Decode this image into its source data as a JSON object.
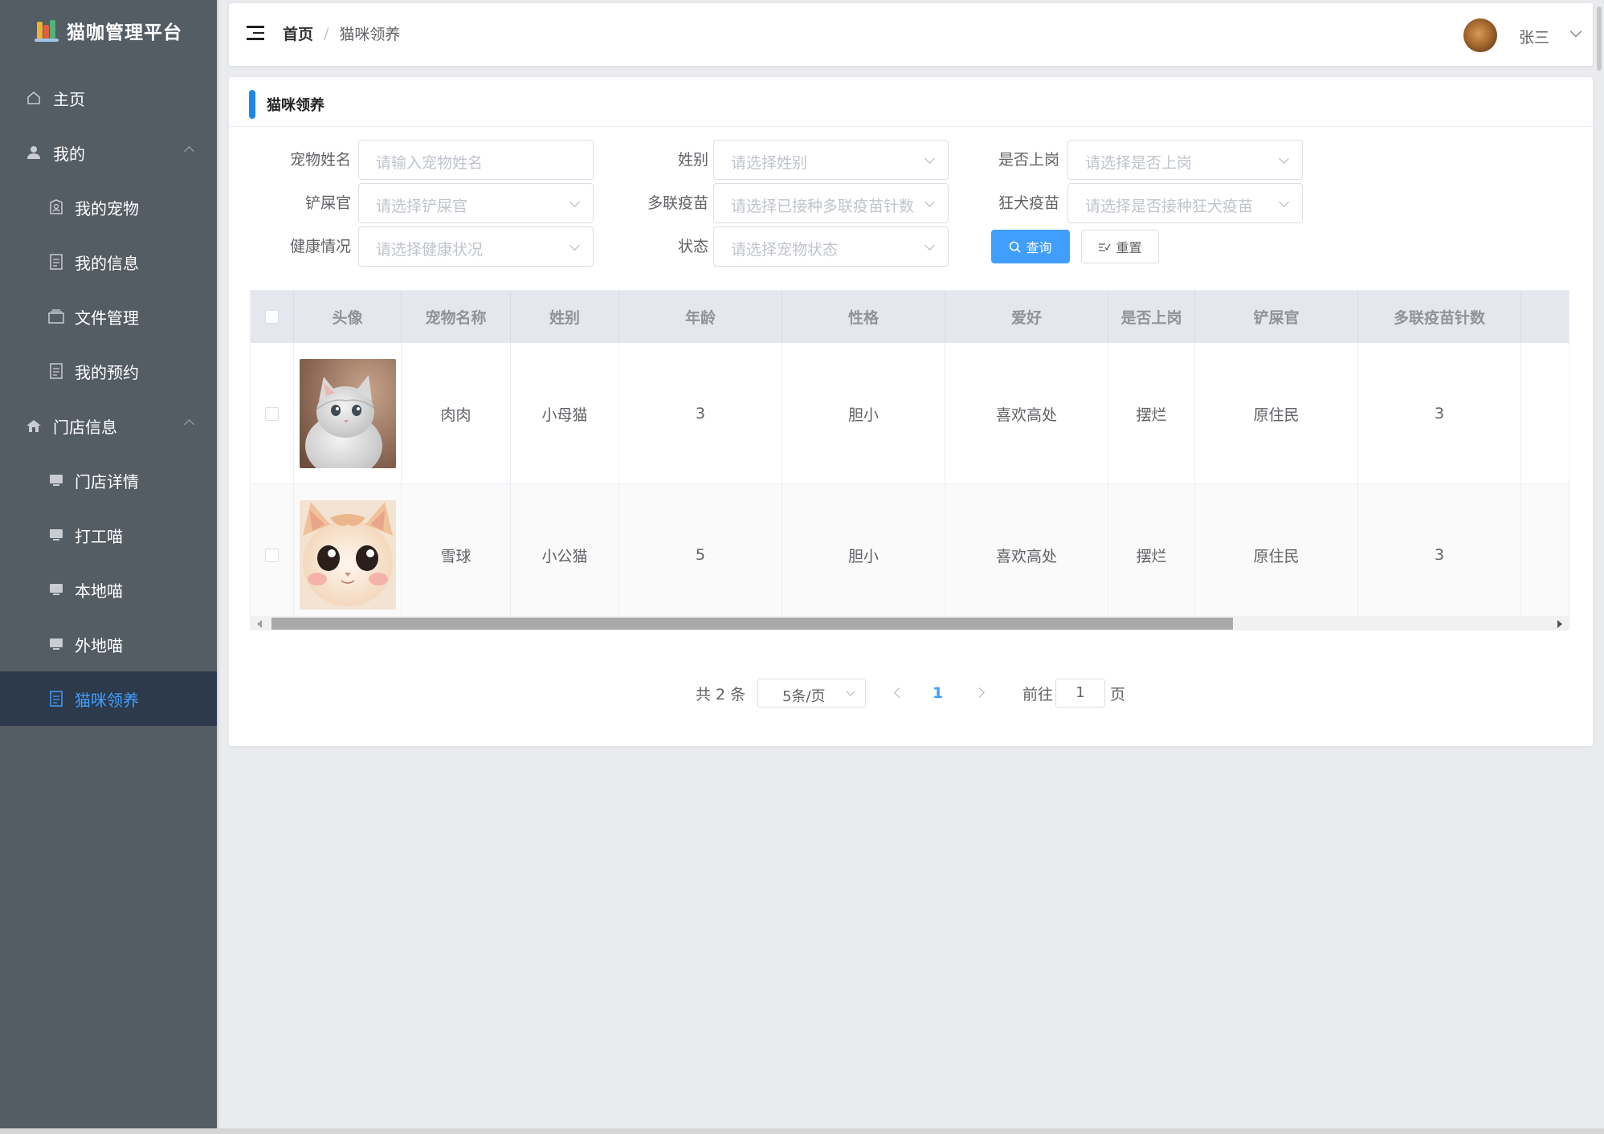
{
  "app": {
    "title": "猫咖管理平台"
  },
  "sidebar": {
    "items": [
      {
        "label": "主页",
        "icon": "home-icon"
      },
      {
        "label": "我的",
        "icon": "user-icon",
        "expanded": true
      },
      {
        "label": "我的宠物",
        "icon": "pet-icon"
      },
      {
        "label": "我的信息",
        "icon": "document-icon"
      },
      {
        "label": "文件管理",
        "icon": "folder-icon"
      },
      {
        "label": "我的预约",
        "icon": "document-icon"
      },
      {
        "label": "门店信息",
        "icon": "store-icon",
        "expanded": true
      },
      {
        "label": "门店详情",
        "icon": "monitor-icon"
      },
      {
        "label": "打工喵",
        "icon": "monitor-icon"
      },
      {
        "label": "本地喵",
        "icon": "monitor-icon"
      },
      {
        "label": "外地喵",
        "icon": "monitor-icon"
      },
      {
        "label": "猫咪领养",
        "icon": "document-icon",
        "active": true
      }
    ]
  },
  "header": {
    "breadcrumb": {
      "home": "首页",
      "separator": "/",
      "current": "猫咪领养"
    },
    "user": {
      "name": "张三"
    }
  },
  "card": {
    "title": "猫咪领养",
    "filters": {
      "name": {
        "label": "宠物姓名",
        "placeholder": "请输入宠物姓名"
      },
      "gender": {
        "label": "姓别",
        "placeholder": "请选择姓别"
      },
      "onduty": {
        "label": "是否上岗",
        "placeholder": "请选择是否上岗"
      },
      "owner": {
        "label": "铲屎官",
        "placeholder": "请选择铲屎官"
      },
      "vaccine": {
        "label": "多联疫苗",
        "placeholder": "请选择已接种多联疫苗针数"
      },
      "rabies": {
        "label": "狂犬疫苗",
        "placeholder": "请选择是否接种狂犬疫苗"
      },
      "health": {
        "label": "健康情况",
        "placeholder": "请选择健康状况"
      },
      "status": {
        "label": "状态",
        "placeholder": "请选择宠物状态"
      }
    },
    "buttons": {
      "query": "查询",
      "reset": "重置"
    },
    "table": {
      "columns": [
        "头像",
        "宠物名称",
        "姓别",
        "年龄",
        "性格",
        "爱好",
        "是否上岗",
        "铲屎官",
        "多联疫苗针数"
      ],
      "rows": [
        {
          "name": "肉肉",
          "gender": "小母猫",
          "age": "3",
          "personality": "胆小",
          "hobby": "喜欢高处",
          "onduty": "摆烂",
          "owner": "原住民",
          "vaccine": "3"
        },
        {
          "name": "雪球",
          "gender": "小公猫",
          "age": "5",
          "personality": "胆小",
          "hobby": "喜欢高处",
          "onduty": "摆烂",
          "owner": "原住民",
          "vaccine": "3"
        }
      ]
    },
    "pagination": {
      "total": "共 2 条",
      "page_size": "5条/页",
      "current": "1",
      "goto_prefix": "前往",
      "goto_value": "1",
      "goto_suffix": "页"
    }
  },
  "colors": {
    "sidebar_bg": "#545c64",
    "active_bg": "#2d3a4b",
    "accent": "#409eff",
    "title_bar": "#1e88e5"
  }
}
